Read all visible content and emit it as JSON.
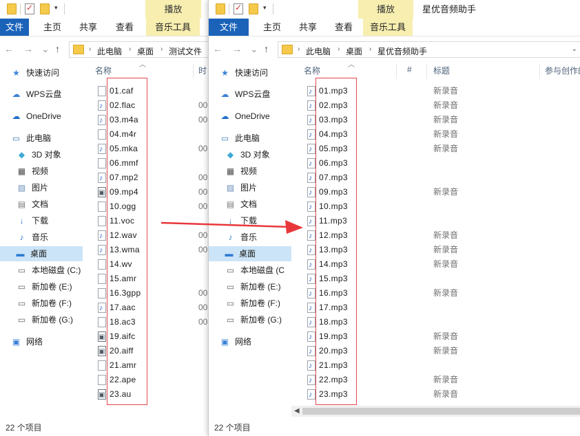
{
  "left": {
    "qat_tab": "播放",
    "title": "",
    "ribbon_tabs": [
      "文件",
      "主页",
      "共享",
      "查看",
      "音乐工具"
    ],
    "breadcrumb": [
      "此电脑",
      "桌面",
      "测试文件"
    ],
    "columns": {
      "name": "名称",
      "time": "时"
    },
    "nav": [
      "快速访问",
      "WPS云盘",
      "OneDrive",
      "此电脑",
      "3D 对象",
      "视频",
      "图片",
      "文档",
      "下载",
      "音乐",
      "桌面",
      "本地磁盘 (C:)",
      "新加卷 (E:)",
      "新加卷 (F:)",
      "新加卷 (G:)",
      "网络"
    ],
    "files": [
      "01.caf",
      "02.flac",
      "03.m4a",
      "04.m4r",
      "05.mka",
      "06.mmf",
      "07.mp2",
      "09.mp4",
      "10.ogg",
      "11.voc",
      "12.wav",
      "13.wma",
      "14.wv",
      "15.amr",
      "16.3gpp",
      "17.aac",
      "18.ac3",
      "19.aifc",
      "20.aiff",
      "21.amr",
      "22.ape",
      "23.au"
    ],
    "times": [
      "",
      "00",
      "00",
      "",
      "00",
      "",
      "00",
      "00",
      "00",
      "",
      "00",
      "00",
      "",
      "",
      "00",
      "00",
      "00",
      "",
      "",
      "",
      "",
      ""
    ],
    "status": "22 个项目"
  },
  "right": {
    "qat_tab": "播放",
    "title": "星优音频助手",
    "ribbon_tabs": [
      "文件",
      "主页",
      "共享",
      "查看",
      "音乐工具"
    ],
    "breadcrumb": [
      "此电脑",
      "桌面",
      "星优音频助手"
    ],
    "columns": {
      "name": "名称",
      "num": "#",
      "title": "标题",
      "artist": "参与创作的"
    },
    "nav": [
      "快速访问",
      "WPS云盘",
      "OneDrive",
      "此电脑",
      "3D 对象",
      "视频",
      "图片",
      "文档",
      "下载",
      "音乐",
      "桌面",
      "本地磁盘 (C",
      "新加卷 (E:)",
      "新加卷 (F:)",
      "新加卷 (G:)",
      "网络"
    ],
    "files": [
      "01.mp3",
      "02.mp3",
      "03.mp3",
      "04.mp3",
      "05.mp3",
      "06.mp3",
      "07.mp3",
      "09.mp3",
      "10.mp3",
      "11.mp3",
      "12.mp3",
      "13.mp3",
      "14.mp3",
      "15.mp3",
      "16.mp3",
      "17.mp3",
      "18.mp3",
      "19.mp3",
      "20.mp3",
      "21.mp3",
      "22.mp3",
      "23.mp3"
    ],
    "titles": [
      "新录音",
      "新录音",
      "新录音",
      "新录音",
      "新录音",
      "",
      "",
      "新录音",
      "",
      "",
      "新录音",
      "新录音",
      "新录音",
      "",
      "新录音",
      "",
      "",
      "新录音",
      "新录音",
      "",
      "新录音",
      "新录音"
    ],
    "status": "22 个项目"
  },
  "icons": {
    "nav": [
      "star-icon",
      "cloud-icon",
      "onedrive-icon",
      "pc-icon",
      "cube-icon",
      "video-icon",
      "picture-icon",
      "document-icon",
      "download-icon",
      "music-icon",
      "desktop-icon",
      "drive-icon",
      "drive-icon",
      "drive-icon",
      "drive-icon",
      "network-icon"
    ],
    "left_file_kinds": [
      "plain",
      "audio",
      "audio",
      "plain",
      "audio",
      "plain",
      "audio",
      "video",
      "plain",
      "plain",
      "audio",
      "audio",
      "plain",
      "plain",
      "plain",
      "audio",
      "plain",
      "video",
      "video",
      "plain",
      "plain",
      "video"
    ]
  },
  "colors": {
    "file_tab": "#1a63b9",
    "music_tab": "#f7eeb0",
    "selected": "#cce4f7",
    "highlight_box": "#e0474c",
    "arrow": "#e8373a"
  }
}
